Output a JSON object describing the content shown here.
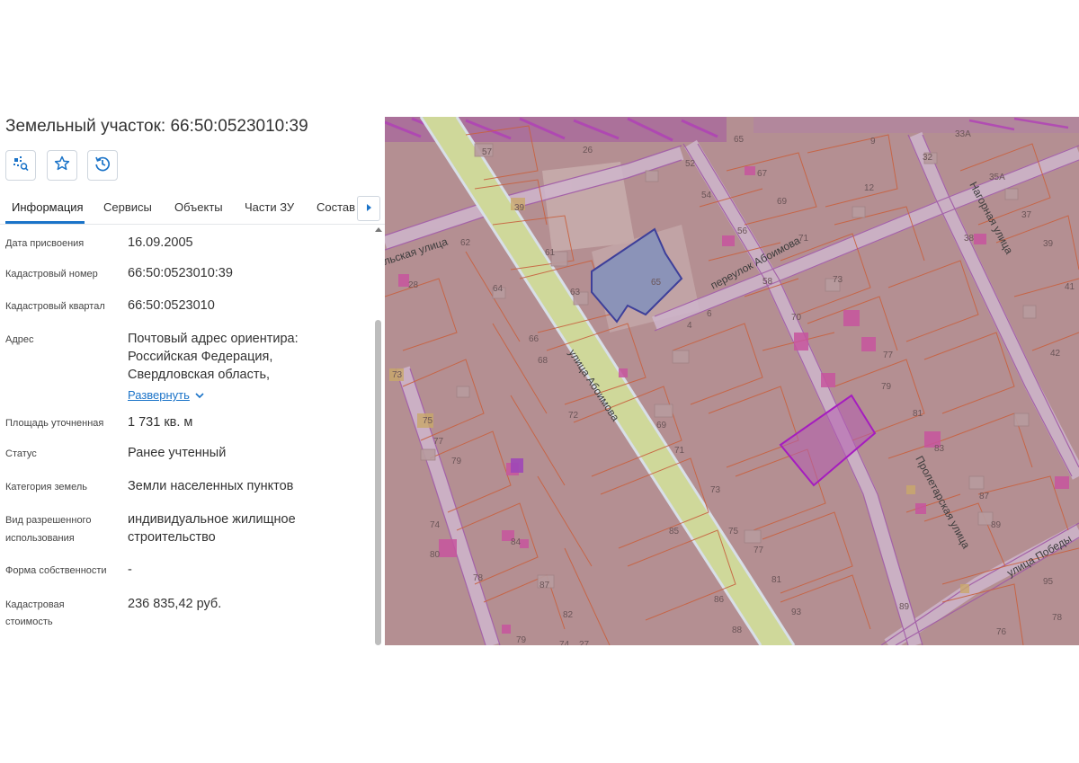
{
  "panel": {
    "title": "Земельный участок: 66:50:0523010:39",
    "toolbar": {
      "icons": [
        "parcel-search-icon",
        "star-icon",
        "history-icon"
      ]
    },
    "tabs": [
      "Информация",
      "Сервисы",
      "Объекты",
      "Части ЗУ",
      "Состав"
    ],
    "active_tab": "Информация",
    "rows": {
      "date_label": "Дата присвоения",
      "date_value": "16.09.2005",
      "cadnum_label": "Кадастровый номер",
      "cadnum_value": "66:50:0523010:39",
      "quarter_label": "Кадастровый квартал",
      "quarter_value": "66:50:0523010",
      "address_label": "Адрес",
      "address_line1": "Почтовый адрес ориентира:",
      "address_line2": "Российская Федерация,",
      "address_line3": "Свердловская область,",
      "expand_link": "Развернуть",
      "area_label": "Площадь уточненная",
      "area_value": "1 731 кв. м",
      "status_label": "Статус",
      "status_value": "Ранее учтенный",
      "category_label": "Категория земель",
      "category_value": "Земли населенных пунктов",
      "use_label_1": "Вид разрешенного",
      "use_label_2": "использования",
      "use_value_1": "индивидуальное жилищное",
      "use_value_2": "строительство",
      "ownership_label": "Форма собственности",
      "ownership_value": "-",
      "cost_label_1": "Кадастровая",
      "cost_label_2": "стоимость",
      "cost_value": "236 835,42 руб."
    }
  },
  "map": {
    "streets": {
      "aboimova": "улица Абоимова",
      "pereulok": "переулок Абоимова",
      "nagornaya": "Нагорная улица",
      "proletarskaya": "Пролетарская улица",
      "pobedy": "улица Победы",
      "partial": "льская улица"
    },
    "house_numbers": [
      "65",
      "57",
      "26",
      "52",
      "9",
      "33А",
      "32",
      "35А",
      "12",
      "54",
      "69",
      "67",
      "37",
      "39",
      "61",
      "71",
      "38",
      "39",
      "63",
      "65",
      "58",
      "56",
      "73",
      "41",
      "62",
      "28",
      "64",
      "66",
      "68",
      "4",
      "70",
      "72",
      "6",
      "77",
      "42",
      "73",
      "75",
      "69",
      "79",
      "81",
      "73",
      "71",
      "77",
      "79",
      "83",
      "87",
      "89",
      "75",
      "77",
      "74",
      "84",
      "86",
      "88",
      "85",
      "87",
      "82",
      "79",
      "81",
      "93",
      "95",
      "78",
      "78",
      "76",
      "80",
      "27",
      "89",
      "74"
    ],
    "colors": {
      "parcel_fill": "#b48f92",
      "boundary": "#c8613f",
      "road": "#d4df9e",
      "selected_outline": "#a832c8",
      "building_outline": "#4a4fa8"
    }
  }
}
